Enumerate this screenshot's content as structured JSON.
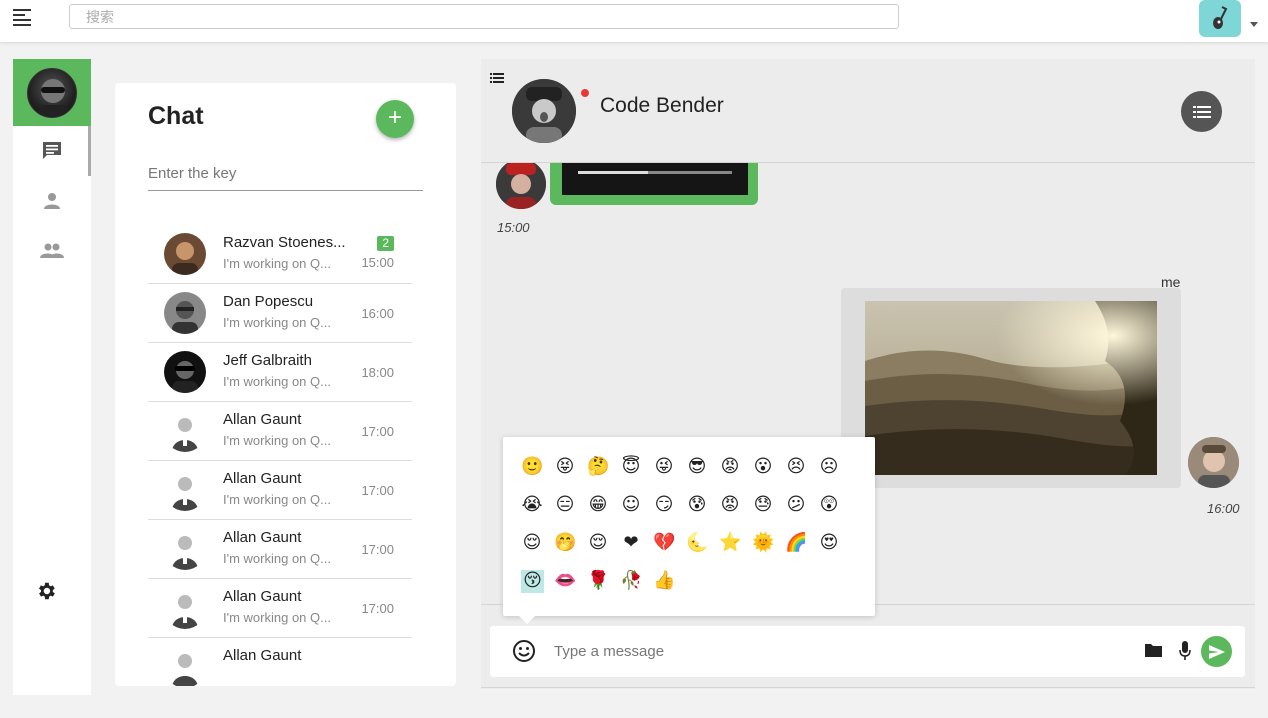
{
  "topbar": {
    "search_placeholder": "搜索"
  },
  "nav": {
    "items": [
      "chat",
      "contacts",
      "groups"
    ],
    "settings_icon": "gear-icon"
  },
  "chat_panel": {
    "title": "Chat",
    "add_label": "+",
    "key_placeholder": "Enter the key",
    "conversations": [
      {
        "name": "Razvan Stoenes...",
        "preview": "I'm working on Q...",
        "time": "15:00",
        "badge": "2"
      },
      {
        "name": "Dan Popescu",
        "preview": "I'm working on Q...",
        "time": "16:00"
      },
      {
        "name": "Jeff Galbraith",
        "preview": "I'm working on Q...",
        "time": "18:00"
      },
      {
        "name": "Allan Gaunt",
        "preview": "I'm working on Q...",
        "time": "17:00"
      },
      {
        "name": "Allan Gaunt",
        "preview": "I'm working on Q...",
        "time": "17:00"
      },
      {
        "name": "Allan Gaunt",
        "preview": "I'm working on Q...",
        "time": "17:00"
      },
      {
        "name": "Allan Gaunt",
        "preview": "I'm working on Q...",
        "time": "17:00"
      },
      {
        "name": "Allan Gaunt",
        "preview": "",
        "time": ""
      }
    ]
  },
  "conversation": {
    "peer_name": "Code Bender",
    "status_color": "#e53935",
    "incoming": {
      "time": "15:00"
    },
    "outgoing": {
      "sender": "me",
      "time": "16:00"
    },
    "composer_placeholder": "Type a message"
  },
  "emoji_picker": {
    "rows": [
      [
        "🙂",
        "😝",
        "🤔",
        "😇",
        "😜",
        "😎",
        "😡",
        "😮",
        "😣",
        "☹"
      ],
      [
        "😭",
        "😑",
        "😁",
        "☺",
        "😏",
        "😰",
        "😡",
        "😓",
        "😕",
        "😲"
      ],
      [
        "😌",
        "🤭",
        "😌",
        "❤",
        "💔",
        "🌜",
        "⭐",
        "🌞",
        "🌈",
        "😍"
      ],
      [
        "😚",
        "👄",
        "🌹",
        "🥀",
        "👍"
      ]
    ],
    "selected": "😚"
  },
  "colors": {
    "accent": "#5cb85c",
    "dark_button": "#555555",
    "top_avatar": "#7fd6d6"
  }
}
